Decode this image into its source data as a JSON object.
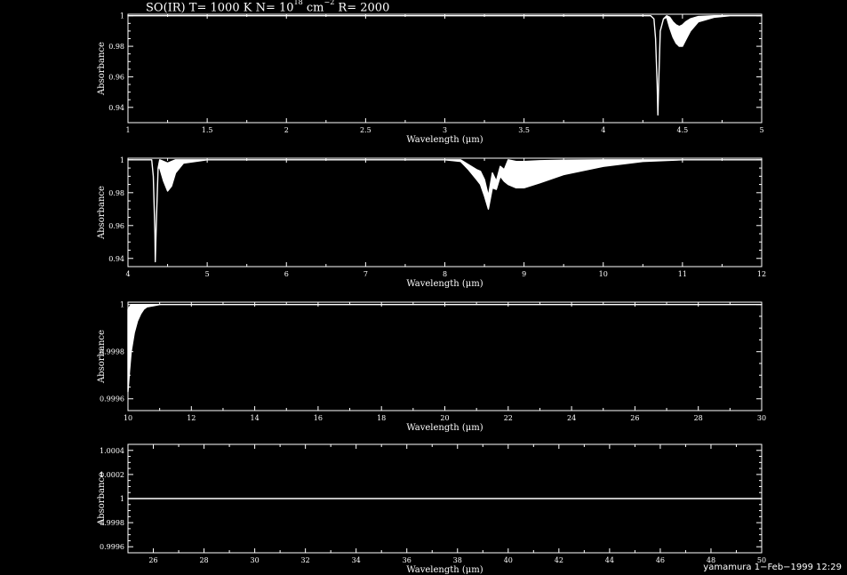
{
  "title": {
    "species": "SO(IR)",
    "temp_label": "T=",
    "temp_value": "1000 K",
    "n_label": "N=",
    "n_base": "10",
    "n_exp": "18",
    "n_unit": "cm",
    "n_unit_exp": "−2",
    "r_label": "R=",
    "r_value": "2000"
  },
  "footer": {
    "author": "yamamura",
    "date": "1−Feb−1999 12:29"
  },
  "colors": {
    "background": "#000000",
    "foreground": "#ffffff"
  },
  "chart_data": [
    {
      "type": "line",
      "xlabel": "Wavelength (μm)",
      "ylabel": "Absorbance",
      "xlim": [
        1,
        5
      ],
      "ylim": [
        0.93,
        1.001
      ],
      "xticks": [
        1,
        1.5,
        2,
        2.5,
        3,
        3.5,
        4,
        4.5,
        5
      ],
      "xticklabels": [
        "1",
        "1.5",
        "2",
        "2.5",
        "3",
        "3.5",
        "4",
        "4.5",
        "5"
      ],
      "yticks": [
        0.94,
        0.96,
        0.98,
        1
      ],
      "yticklabels": [
        "0.94",
        "0.96",
        "0.98",
        "1"
      ],
      "grid": false,
      "series": [
        {
          "style": "filled-band",
          "x": [
            1.0,
            4.3,
            4.32,
            4.33,
            4.34,
            4.345,
            4.35,
            4.36,
            4.38,
            4.4,
            4.42,
            4.44,
            4.46,
            4.48,
            4.5,
            4.52,
            4.55,
            4.6,
            4.7,
            4.8,
            5.0
          ],
          "upper": [
            1.0,
            1.0,
            0.998,
            0.985,
            0.955,
            0.935,
            0.955,
            0.99,
            0.998,
            1.0,
            0.999,
            0.996,
            0.994,
            0.993,
            0.994,
            0.996,
            0.998,
            0.9995,
            1.0,
            1.0,
            1.0
          ],
          "lower": [
            1.0,
            1.0,
            0.998,
            0.985,
            0.955,
            0.935,
            0.955,
            0.99,
            0.998,
            0.999,
            0.992,
            0.986,
            0.982,
            0.98,
            0.98,
            0.984,
            0.99,
            0.996,
            0.999,
            1.0,
            1.0
          ]
        }
      ]
    },
    {
      "type": "line",
      "xlabel": "Wavelength (μm)",
      "ylabel": "Absorbance",
      "xlim": [
        4,
        12
      ],
      "ylim": [
        0.935,
        1.001
      ],
      "xticks": [
        4,
        5,
        6,
        7,
        8,
        9,
        10,
        11,
        12
      ],
      "xticklabels": [
        "4",
        "5",
        "6",
        "7",
        "8",
        "9",
        "10",
        "11",
        "12"
      ],
      "yticks": [
        0.94,
        0.96,
        0.98,
        1
      ],
      "yticklabels": [
        "0.94",
        "0.96",
        "0.98",
        "1"
      ],
      "grid": false,
      "series": [
        {
          "style": "filled-band",
          "x": [
            4.0,
            4.3,
            4.32,
            4.34,
            4.345,
            4.36,
            4.38,
            4.4,
            4.45,
            4.5,
            4.55,
            4.6,
            4.7,
            5.0,
            8.0,
            8.2,
            8.3,
            8.4,
            8.45,
            8.5,
            8.55,
            8.6,
            8.65,
            8.7,
            8.75,
            8.8,
            8.9,
            9.0,
            9.2,
            9.5,
            10.0,
            10.5,
            11.0,
            12.0
          ],
          "upper": [
            1.0,
            1.0,
            0.99,
            0.955,
            0.938,
            0.965,
            0.995,
            1.0,
            0.999,
            0.998,
            0.999,
            1.0,
            1.0,
            1.0,
            1.0,
            1.0,
            0.997,
            0.994,
            0.993,
            0.988,
            0.978,
            0.992,
            0.987,
            0.996,
            0.994,
            1.0,
            0.999,
            0.999,
            0.9995,
            0.9998,
            1.0,
            1.0,
            1.0,
            1.0
          ],
          "lower": [
            1.0,
            1.0,
            0.99,
            0.955,
            0.938,
            0.965,
            0.995,
            0.995,
            0.987,
            0.981,
            0.984,
            0.992,
            0.998,
            1.0,
            1.0,
            0.999,
            0.994,
            0.988,
            0.985,
            0.978,
            0.97,
            0.983,
            0.982,
            0.99,
            0.987,
            0.985,
            0.983,
            0.983,
            0.986,
            0.991,
            0.996,
            0.999,
            1.0,
            1.0
          ]
        }
      ]
    },
    {
      "type": "area",
      "xlabel": "Wavelength (μm)",
      "ylabel": "Absorbance",
      "xlim": [
        10,
        30
      ],
      "ylim": [
        0.99955,
        1.00001
      ],
      "xticks": [
        10,
        12,
        14,
        16,
        18,
        20,
        22,
        24,
        26,
        28,
        30
      ],
      "xticklabels": [
        "10",
        "12",
        "14",
        "16",
        "18",
        "20",
        "22",
        "24",
        "26",
        "28",
        "30"
      ],
      "yticks": [
        0.9996,
        0.9998,
        1
      ],
      "yticklabels": [
        "0.9996",
        "0.9998",
        "1"
      ],
      "grid": false,
      "series": [
        {
          "style": "filled-band",
          "x": [
            10.0,
            10.05,
            10.1,
            10.2,
            10.3,
            10.4,
            10.5,
            10.6,
            10.8,
            11.0,
            11.5,
            30.0
          ],
          "upper": [
            0.99998,
            0.99999,
            1.0,
            1.0,
            1.0,
            1.0,
            1.0,
            1.0,
            1.0,
            1.0,
            1.0,
            1.0
          ],
          "lower": [
            0.99963,
            0.99972,
            0.9998,
            0.99988,
            0.99993,
            0.99996,
            0.99998,
            0.99999,
            0.999995,
            1.0,
            1.0,
            1.0
          ]
        }
      ]
    },
    {
      "type": "line",
      "xlabel": "Wavelength (μm)",
      "ylabel": "Absorbance",
      "xlim": [
        25,
        50
      ],
      "ylim": [
        0.99955,
        1.00045
      ],
      "xticks": [
        26,
        28,
        30,
        32,
        34,
        36,
        38,
        40,
        42,
        44,
        46,
        48,
        50
      ],
      "xticklabels": [
        "26",
        "28",
        "30",
        "32",
        "34",
        "36",
        "38",
        "40",
        "42",
        "44",
        "46",
        "48",
        "50"
      ],
      "yticks": [
        0.9996,
        0.9998,
        1,
        1.0002,
        1.0004
      ],
      "yticklabels": [
        "0.9996",
        "0.9998",
        "1",
        "1.0002",
        "1.0004"
      ],
      "grid": false,
      "series": [
        {
          "style": "line",
          "x": [
            25,
            50
          ],
          "upper": [
            1.0,
            1.0
          ],
          "lower": [
            1.0,
            1.0
          ]
        }
      ]
    }
  ]
}
